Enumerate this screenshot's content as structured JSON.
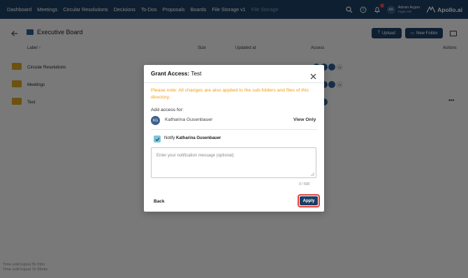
{
  "nav": {
    "links": [
      "Dashboard",
      "Meetings",
      "Circular Resolutions",
      "Decisions",
      "To-Dos",
      "Proposals",
      "Boards",
      "File Storage v1",
      "File Storage"
    ],
    "user": {
      "initials": "AA",
      "name": "Admin Argon",
      "org": "Argon AG"
    },
    "logo": "Apollo.ai"
  },
  "page": {
    "title": "Executive Board",
    "upload_label": "Upload",
    "new_folder_label": "New Folder"
  },
  "table": {
    "headers": {
      "label": "Label",
      "size": "Size",
      "updated": "Updated at",
      "access": "Access",
      "actions": "Actions"
    },
    "rows": [
      {
        "label": "Circular Resolutions",
        "access_extra": "+1"
      },
      {
        "label": "Meetings",
        "access_extra": "+1"
      },
      {
        "label": "Test",
        "access_extra": ""
      }
    ]
  },
  "session": {
    "line1": "Time until logout",
    "value1": "5h 59m",
    "line2": "Time until logout",
    "value2": "1h 59min"
  },
  "modal": {
    "title_prefix": "Grant Access:",
    "title_name": "Test",
    "note": "Please note: All changes are also applied to the sub-folders and files of this directory.",
    "add_access_label": "Add access for:",
    "user_initials": "KG",
    "user_name": "Katharina Gusenbauer",
    "permission": "View Only",
    "notify_prefix": "Notify",
    "notify_name": "Katharina Gusenbauer",
    "message_placeholder": "Enter your notification message (optional)",
    "counter": "0 / 500",
    "back_label": "Back",
    "apply_label": "Apply"
  },
  "colors": {
    "nav_bg": "#1d3e63",
    "note_orange": "#f39c12",
    "folder": "#d9a520",
    "highlight": "#e0413d"
  }
}
